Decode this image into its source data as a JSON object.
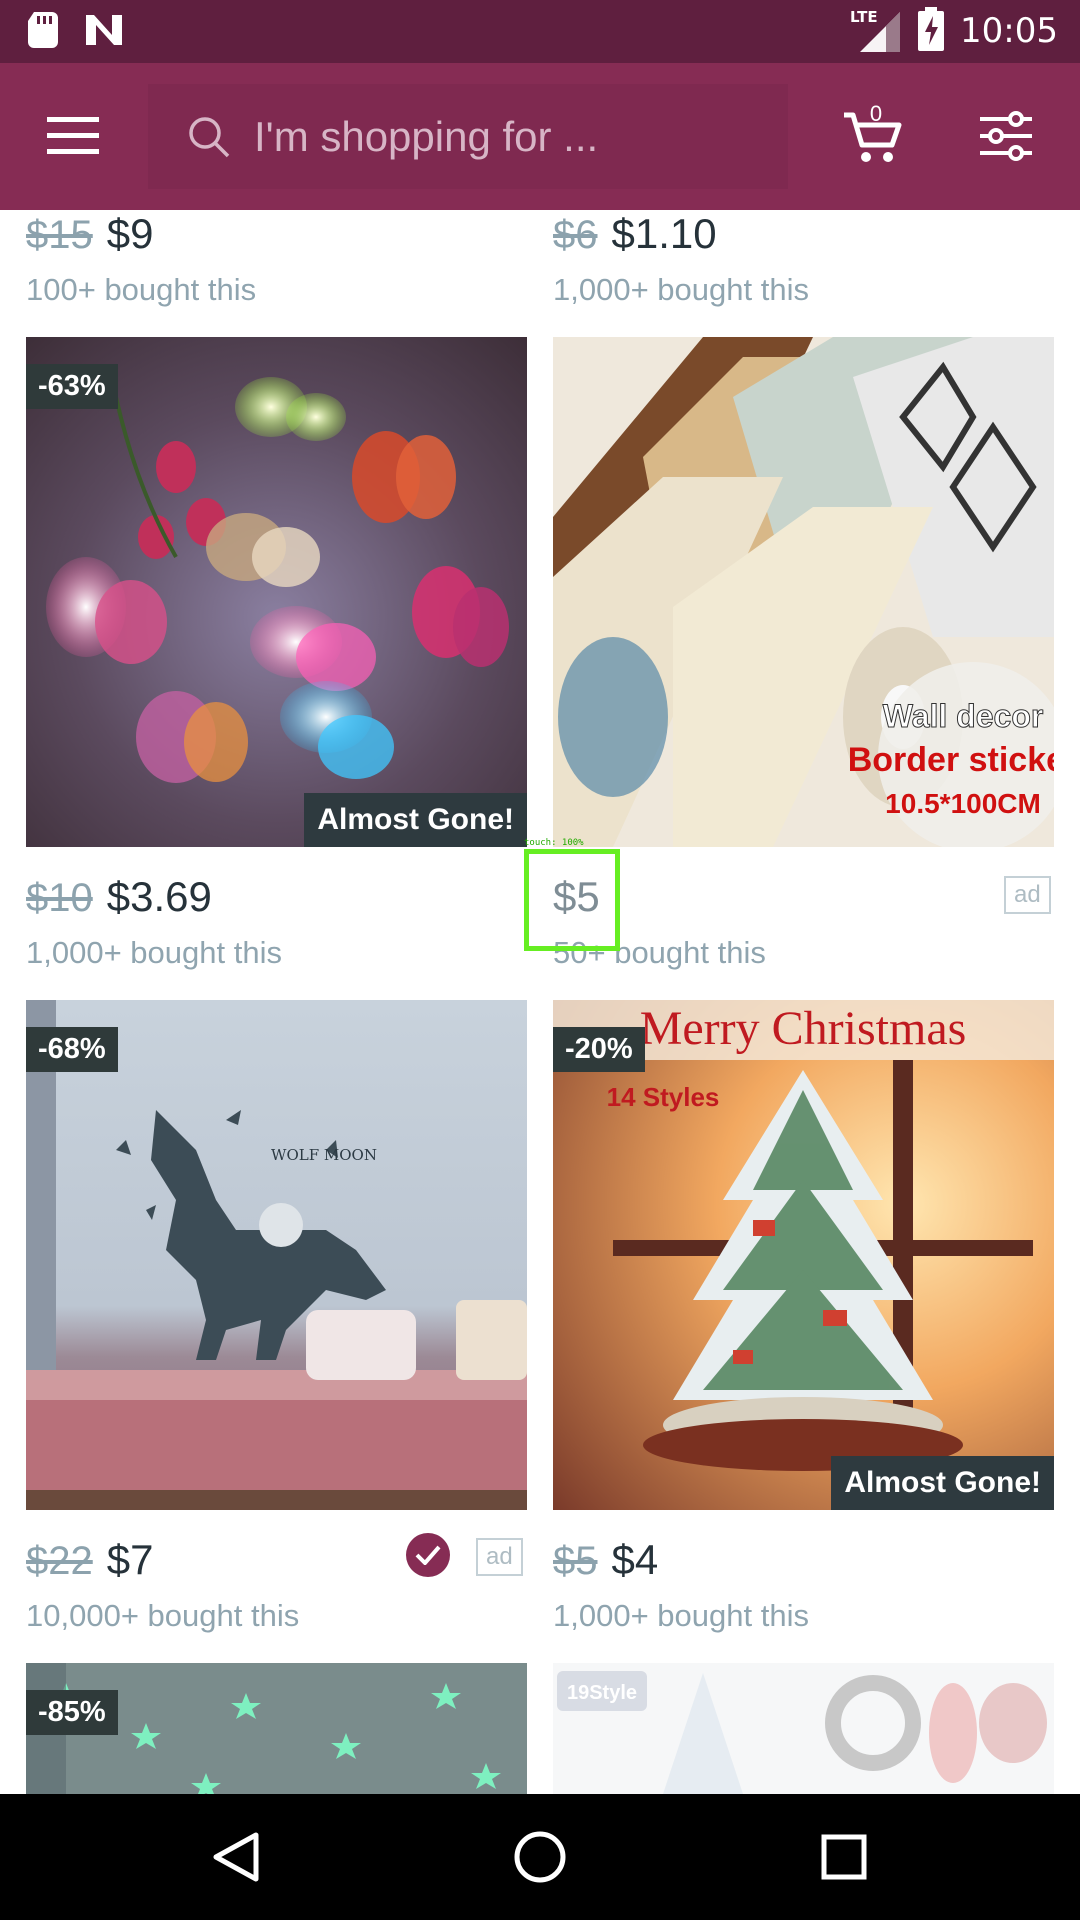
{
  "status": {
    "time": "10:05",
    "network": "LTE"
  },
  "header": {
    "search_placeholder": "I'm shopping for ...",
    "cart_count": "0"
  },
  "top_row": [
    {
      "old_price": "$15",
      "price": "$9",
      "bought": "100+ bought this"
    },
    {
      "old_price": "$6",
      "price": "$1.10",
      "bought": "1,000+ bought this"
    }
  ],
  "products": [
    {
      "discount": "-63%",
      "badge": "Almost Gone!",
      "old_price": "$10",
      "price": "$3.69",
      "bought": "1,000+ bought this"
    },
    {
      "image_text": [
        "Wall decor",
        "Border sticker",
        "10.5*100CM"
      ],
      "price": "$5",
      "bought": "50+ bought this",
      "ad": "ad",
      "touch_label": "touch: 100%"
    },
    {
      "discount": "-68%",
      "image_text": "WOLF MOON",
      "old_price": "$22",
      "price": "$7",
      "bought": "10,000+ bought this",
      "ad": "ad"
    },
    {
      "discount": "-20%",
      "image_text": [
        "Merry Christmas",
        "14 Styles"
      ],
      "badge": "Almost Gone!",
      "old_price": "$5",
      "price": "$4",
      "bought": "1,000+ bought this"
    },
    {
      "discount": "-85%"
    },
    {
      "image_text": "19Style"
    }
  ],
  "colors": {
    "status_bar": "#5f1f3f",
    "header": "#862c54",
    "badge": "#2f3a3a"
  }
}
